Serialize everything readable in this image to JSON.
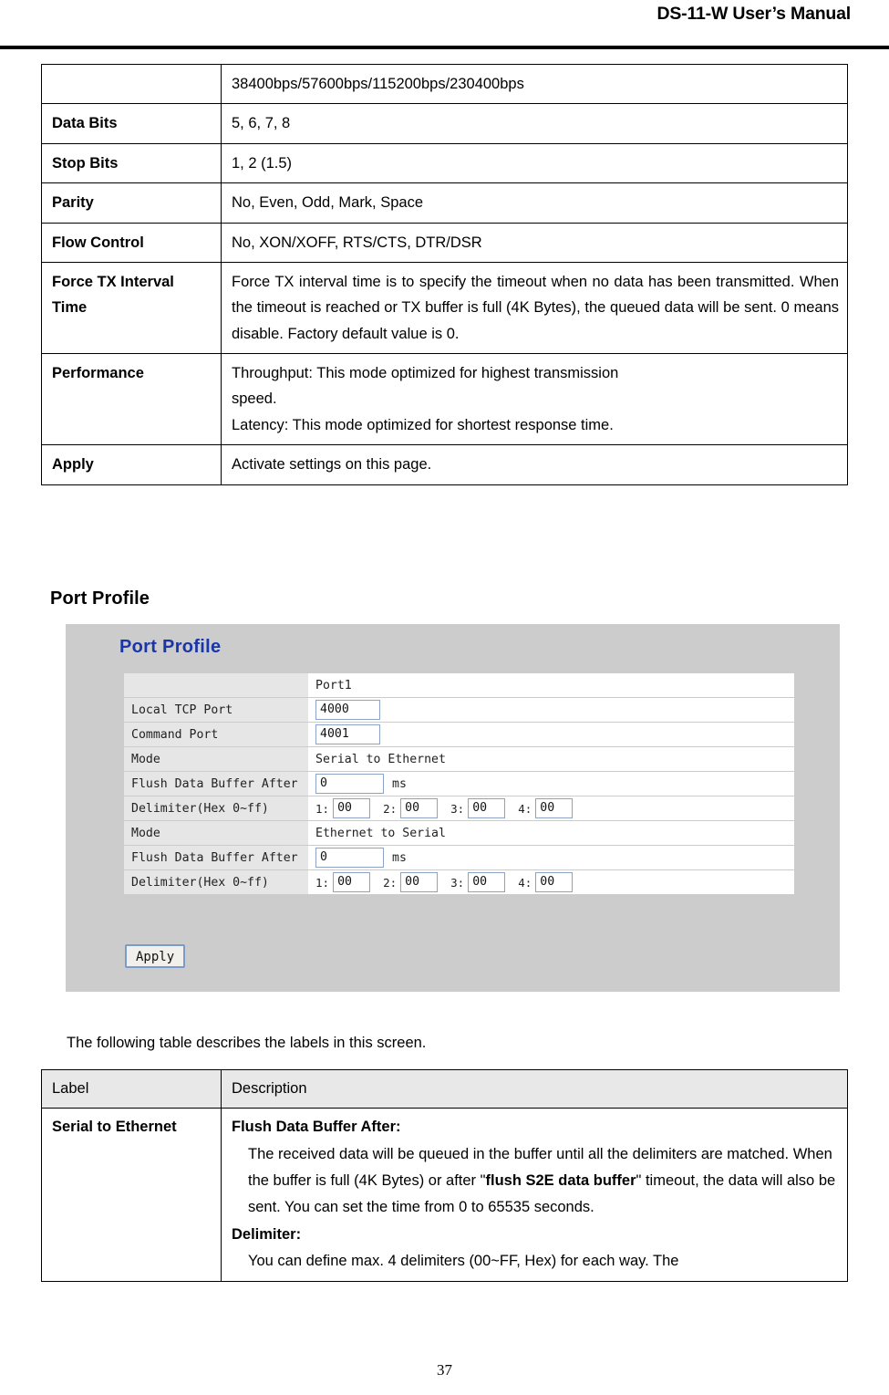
{
  "header": {
    "title": "DS-11-W User’s Manual"
  },
  "spec_table": {
    "rows": [
      {
        "label": "",
        "value": "38400bps/57600bps/115200bps/230400bps"
      },
      {
        "label": "Data Bits",
        "value": "5, 6, 7, 8"
      },
      {
        "label": "Stop Bits",
        "value": "1, 2 (1.5)"
      },
      {
        "label": "Parity",
        "value": "No, Even, Odd, Mark, Space"
      },
      {
        "label": "Flow Control",
        "value": "No, XON/XOFF, RTS/CTS, DTR/DSR"
      },
      {
        "label": "Force TX Interval Time",
        "value": "Force TX interval time is to specify the timeout when no data has been transmitted.  When the timeout is reached or TX buffer is full (4K Bytes), the queued data will be sent.  0 means disable.  Factory default value is 0."
      },
      {
        "label": "Performance",
        "value_line1": "Throughput: This mode optimized for highest transmission",
        "value_line2": "speed.",
        "value_line3": "Latency: This mode optimized for shortest response time."
      },
      {
        "label": "Apply",
        "value": "Activate settings on this page."
      }
    ]
  },
  "section": {
    "heading": "Port Profile"
  },
  "screenshot": {
    "title": "Port Profile",
    "column_header": "Port1",
    "rows": {
      "local_tcp_port_label": "Local TCP Port",
      "local_tcp_port_value": "4000",
      "command_port_label": "Command Port",
      "command_port_value": "4001",
      "mode_label_1": "Mode",
      "mode_value_1": "Serial to Ethernet",
      "flush_label_1": "Flush Data Buffer After",
      "flush_value_1": "0",
      "flush_unit_1": "ms",
      "delimiter_label_1": "Delimiter(Hex 0~ff)",
      "mode_label_2": "Mode",
      "mode_value_2": "Ethernet to Serial",
      "flush_label_2": "Flush Data Buffer After",
      "flush_value_2": "0",
      "flush_unit_2": "ms",
      "delimiter_label_2": "Delimiter(Hex 0~ff)"
    },
    "delimiters_s2e": [
      {
        "num": "1:",
        "value": "00"
      },
      {
        "num": "2:",
        "value": "00"
      },
      {
        "num": "3:",
        "value": "00"
      },
      {
        "num": "4:",
        "value": "00"
      }
    ],
    "delimiters_e2s": [
      {
        "num": "1:",
        "value": "00"
      },
      {
        "num": "2:",
        "value": "00"
      },
      {
        "num": "3:",
        "value": "00"
      },
      {
        "num": "4:",
        "value": "00"
      }
    ],
    "apply_label": "Apply",
    "colors": {
      "panel_bg": "#cccccc",
      "title_color": "#1a35a8",
      "label_cell_bg": "#e6e6e6",
      "input_border": "#8ba3c7"
    }
  },
  "intro": {
    "text": "The following table describes the labels in this screen."
  },
  "desc_table": {
    "headers": {
      "label": "Label",
      "description": "Description"
    },
    "row": {
      "label": "Serial to Ethernet",
      "d_head1": "Flush Data Buffer After:",
      "d_body1_a": "The received data will be queued in the buffer until all the delimiters are matched.   When the buffer is full (4K Bytes) or after \"",
      "d_body1_b": "flush S2E data buffer",
      "d_body1_c": "\" timeout, the data will also be sent.   You can set the time from 0 to 65535 seconds.",
      "d_head2": "Delimiter:",
      "d_body2": "You can define max. 4 delimiters (00~FF, Hex) for each way.   The"
    }
  },
  "footer": {
    "page_number": "37"
  }
}
